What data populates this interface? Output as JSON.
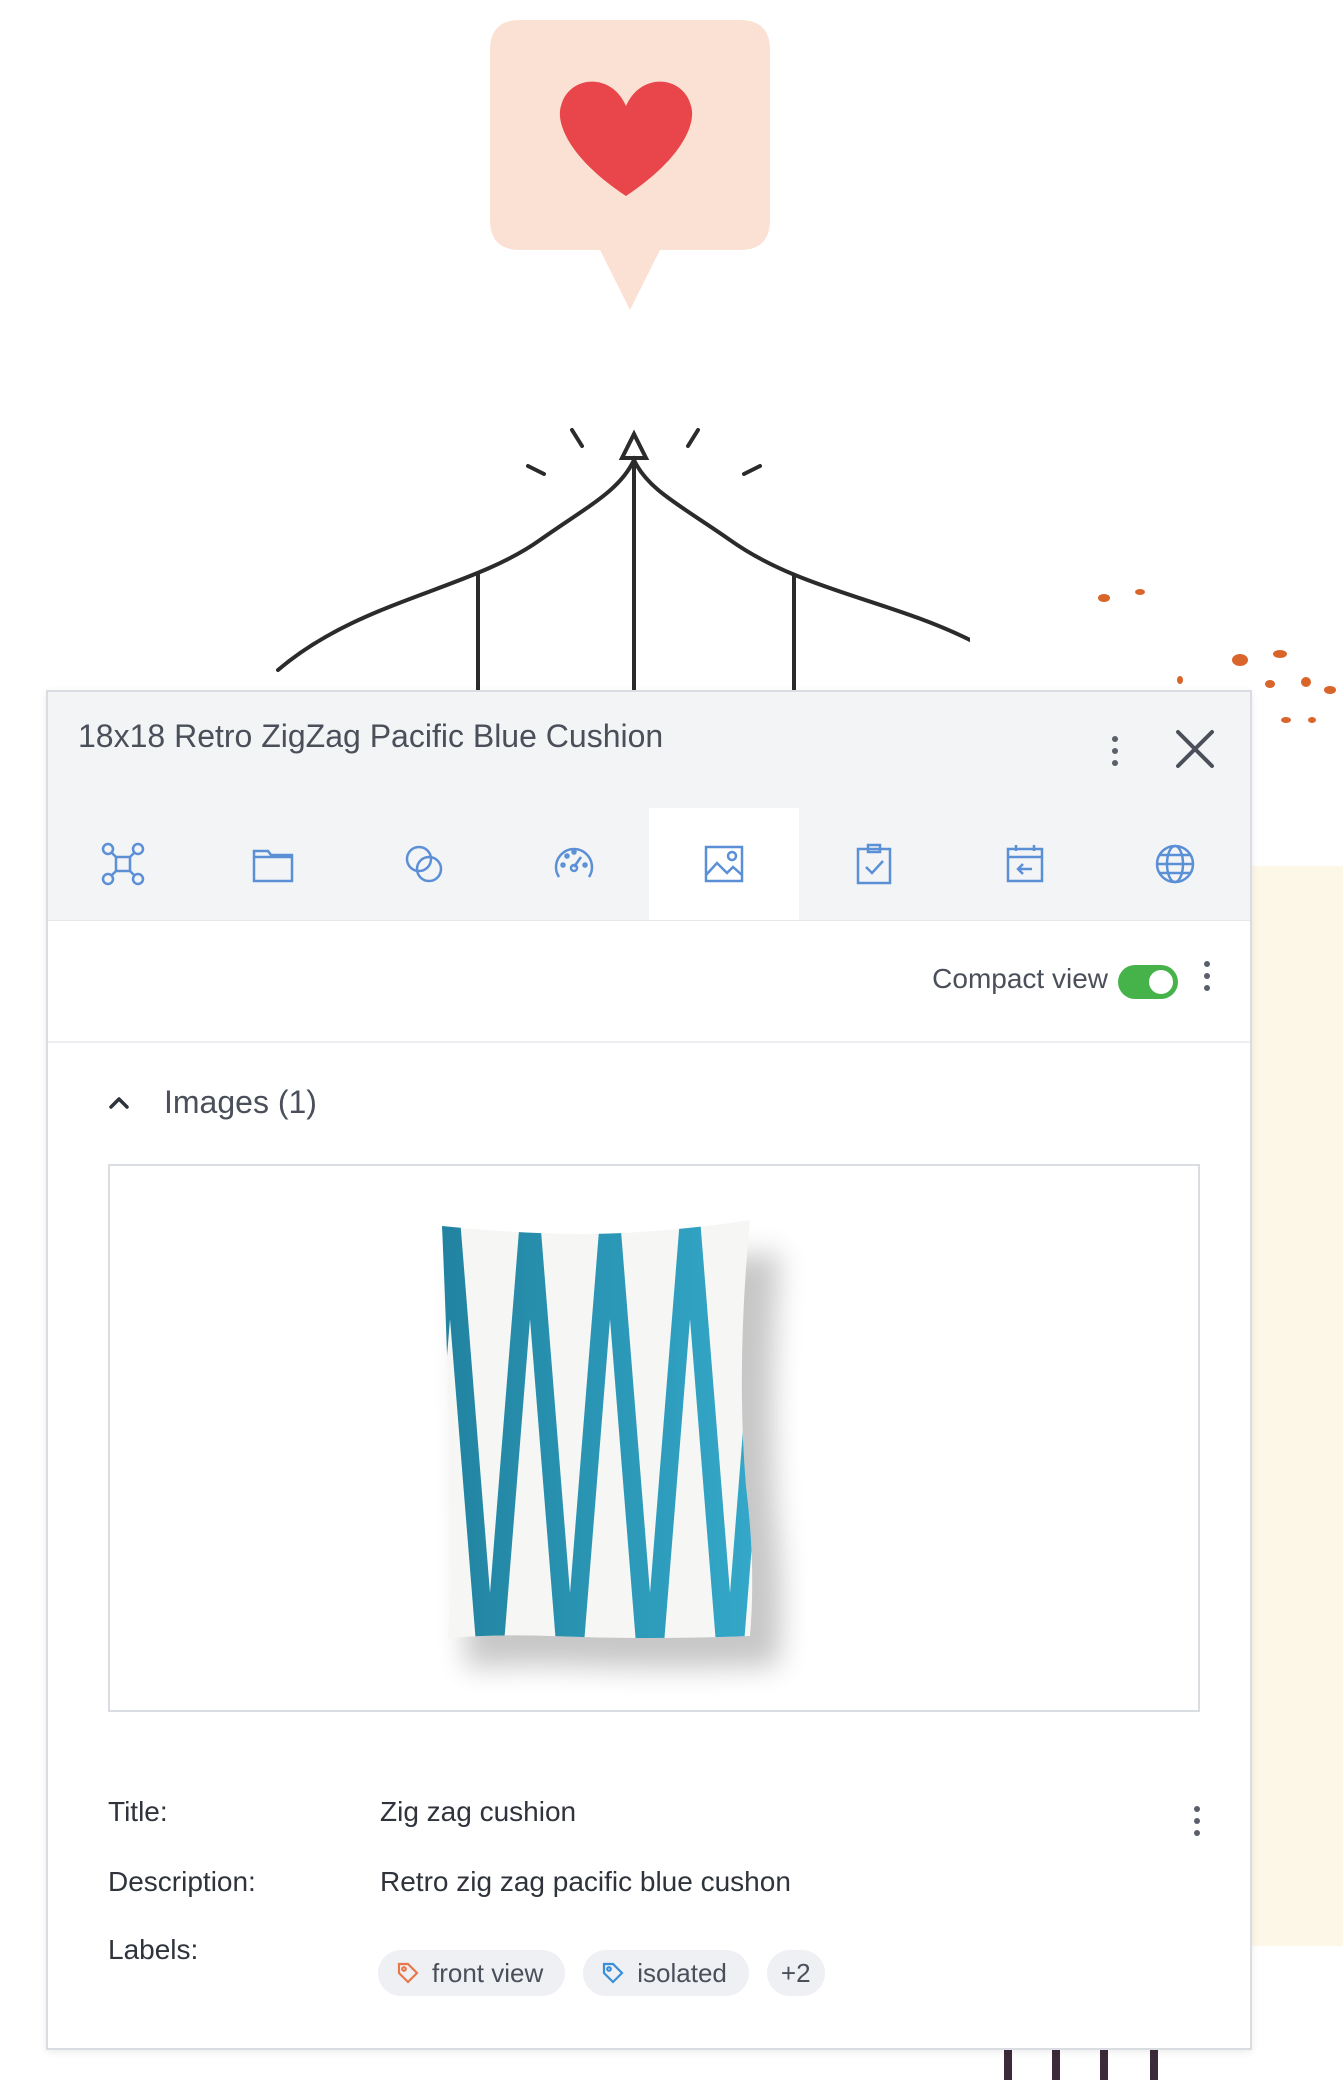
{
  "panel": {
    "title": "18x18 Retro ZigZag Pacific Blue Cushion",
    "tabs": [
      {
        "icon": "graph-nodes-icon"
      },
      {
        "icon": "folder-icon"
      },
      {
        "icon": "linked-circles-icon"
      },
      {
        "icon": "dashboard-gauge-icon"
      },
      {
        "icon": "image-icon",
        "active": true
      },
      {
        "icon": "clipboard-check-icon"
      },
      {
        "icon": "calendar-import-icon"
      },
      {
        "icon": "globe-icon"
      }
    ],
    "compact_view_label": "Compact view",
    "compact_view_enabled": true,
    "images_section": {
      "heading": "Images (1)",
      "image": {
        "title_label": "Title:",
        "title": "Zig zag cushion",
        "description_label": "Description:",
        "description": "Retro zig zag pacific blue cushon",
        "labels_label": "Labels:",
        "labels": [
          "front view",
          "isolated"
        ],
        "more_labels": "+2"
      }
    }
  },
  "colors": {
    "toggle_on": "#46b34a",
    "heart": "#e8464a",
    "cushion_stripe": "#2b97b3",
    "label_tag_orange": "#e8784a",
    "label_tag_blue": "#3a8fd8",
    "accent_icon": "#5b8fd6"
  }
}
